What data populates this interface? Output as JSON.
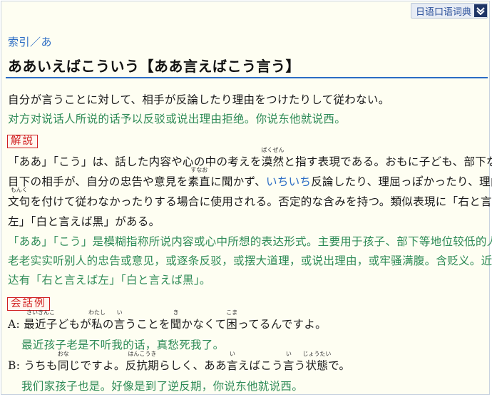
{
  "dict_tag": "日语口语词典",
  "breadcrumb": "索引／あ",
  "headword": "ああいえばこういう【ああ言えばこう言う】",
  "definition_ja": "自分が言うことに対して、相手が反論したり理由をつけたりして従わない。",
  "definition_cn": "对方对说话人所说的话予以反驳或说出理由拒绝。你说东他就说西。",
  "commentary": {
    "label": "解説",
    "ja": {
      "l1_a": "「ああ」「こう」は、話した内容や心の中の考えを",
      "l1_b": "漠然",
      "l1_b_rt": "ばくぜん",
      "l1_c": "と指す表現である。おもに子ども、部下など",
      "l2_a": "目下の相手が、自分の忠告や意見を",
      "l2_b": "素直",
      "l2_b_rt": "すなお",
      "l2_c": "に聞かず、",
      "l2_link": "いちいち",
      "l2_d": "反論したり、理屈っぽかったり、理由や",
      "l3_a": "文句",
      "l3_a_rt": "もんく",
      "l3_b": "を付けて従わなかったりする場合に使用される。否定的な含みを持つ。類似表現に「右と言えば",
      "l4": "左」「白と言えば黒」がある。"
    },
    "cn": {
      "l1": "「ああ」「こう」是模糊指称所说内容或心中所想的表达形式。主要用于孩子、部下等地位较低的人不",
      "l2": "老老实实听别人的忠告或意见，或逐条反驳，或摆大道理，或说出理由，或牢骚满腹。含贬义。近义表",
      "l3": "达有「右と言えば左」「白と言えば黒」。"
    }
  },
  "examples": {
    "label": "会話例",
    "a": {
      "speaker": "A: ",
      "p1": "最近子",
      "p1_rt": "さいきんこ",
      "p2": "どもが",
      "p3": "私",
      "p3_rt": "わたし",
      "p4": "の",
      "p5": "言",
      "p5_rt": "い",
      "p6": "うことを",
      "p7": "聞",
      "p7_rt": "き",
      "p8": "かなくて",
      "p9": "困",
      "p9_rt": "こま",
      "p10": "ってるんですよ。",
      "cn": "最近孩子老是不听我的话，真愁死我了。"
    },
    "b": {
      "speaker": "B: ",
      "p1": "うちも",
      "p2": "同",
      "p2_rt": "おな",
      "p3": "じですよ。",
      "p4": "反抗期",
      "p4_rt": "はんこうき",
      "p5": "らしく、ああ",
      "p6": "言",
      "p6_rt": "い",
      "p7": "えばこう",
      "p8": "言",
      "p8_rt": "い",
      "p9": "う",
      "p10": "状態",
      "p10_rt": "じょうたい",
      "p11": "で。",
      "cn": "我们家孩子也是。好像是到了逆反期，你说东他就说西。"
    }
  },
  "colors": {
    "link": "#2b6cc4",
    "chinese": "#2e8b57",
    "tag_red": "#d02020"
  }
}
